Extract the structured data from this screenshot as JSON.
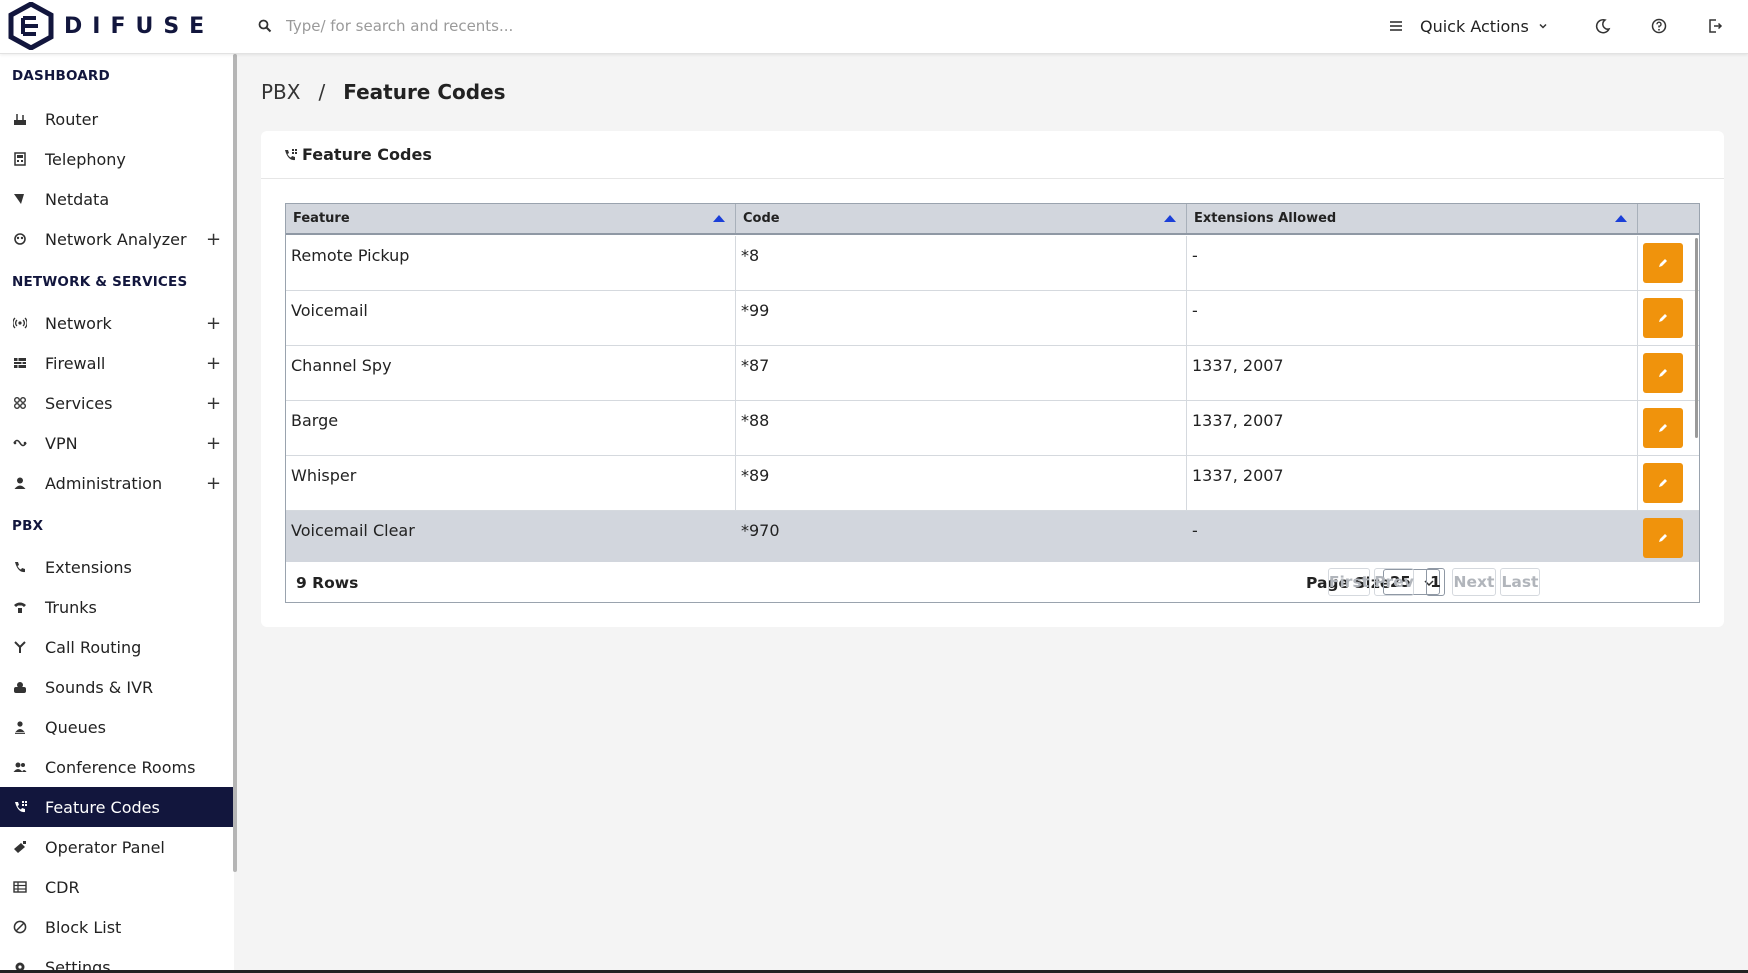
{
  "app": {
    "logo_text": "DIFUSE"
  },
  "search": {
    "placeholder": "Type/ for search and recents..."
  },
  "header": {
    "quick_actions": "Quick Actions"
  },
  "sidebar": {
    "sections": [
      {
        "title": "DASHBOARD",
        "items": [
          {
            "label": "Router",
            "icon": "router-icon"
          },
          {
            "label": "Telephony",
            "icon": "telephony-icon"
          },
          {
            "label": "Netdata",
            "icon": "netdata-icon"
          },
          {
            "label": "Network Analyzer",
            "icon": "network-analyzer-icon",
            "expandable": true
          }
        ]
      },
      {
        "title": "NETWORK & SERVICES",
        "items": [
          {
            "label": "Network",
            "icon": "network-icon",
            "expandable": true
          },
          {
            "label": "Firewall",
            "icon": "firewall-icon",
            "expandable": true
          },
          {
            "label": "Services",
            "icon": "services-icon",
            "expandable": true
          },
          {
            "label": "VPN",
            "icon": "vpn-icon",
            "expandable": true
          },
          {
            "label": "Administration",
            "icon": "administration-icon",
            "expandable": true
          }
        ]
      },
      {
        "title": "PBX",
        "items": [
          {
            "label": "Extensions",
            "icon": "phone-icon"
          },
          {
            "label": "Trunks",
            "icon": "trunks-icon"
          },
          {
            "label": "Call Routing",
            "icon": "call-routing-icon"
          },
          {
            "label": "Sounds & IVR",
            "icon": "sounds-icon"
          },
          {
            "label": "Queues",
            "icon": "queues-icon"
          },
          {
            "label": "Conference Rooms",
            "icon": "conference-icon"
          },
          {
            "label": "Feature Codes",
            "icon": "feature-codes-icon",
            "active": true
          },
          {
            "label": "Operator Panel",
            "icon": "operator-panel-icon"
          },
          {
            "label": "CDR",
            "icon": "cdr-icon"
          },
          {
            "label": "Block List",
            "icon": "block-icon"
          },
          {
            "label": "Settings",
            "icon": "settings-icon"
          }
        ]
      }
    ]
  },
  "breadcrumb": {
    "parent": "PBX",
    "separator": "/",
    "current": "Feature Codes"
  },
  "card": {
    "title": "Feature Codes"
  },
  "table": {
    "columns": [
      "Feature",
      "Code",
      "Extensions Allowed"
    ],
    "rows": [
      {
        "feature": "Remote Pickup",
        "code": "*8",
        "extensions": "-"
      },
      {
        "feature": "Voicemail",
        "code": "*99",
        "extensions": "-"
      },
      {
        "feature": "Channel Spy",
        "code": "*87",
        "extensions": "1337, 2007"
      },
      {
        "feature": "Barge",
        "code": "*88",
        "extensions": "1337, 2007"
      },
      {
        "feature": "Whisper",
        "code": "*89",
        "extensions": "1337, 2007"
      },
      {
        "feature": "Voicemail Clear",
        "code": "*970",
        "extensions": "-"
      }
    ],
    "footer": {
      "rows_count": "9 Rows",
      "page_size_label": "Page Size",
      "page_size": "25",
      "first": "First",
      "prev": "Prev",
      "page": "1",
      "next": "Next",
      "last": "Last"
    }
  },
  "colors": {
    "brand": "#12163d",
    "edit_button": "#f0930c",
    "sort_arrow": "#1b3fd8"
  }
}
